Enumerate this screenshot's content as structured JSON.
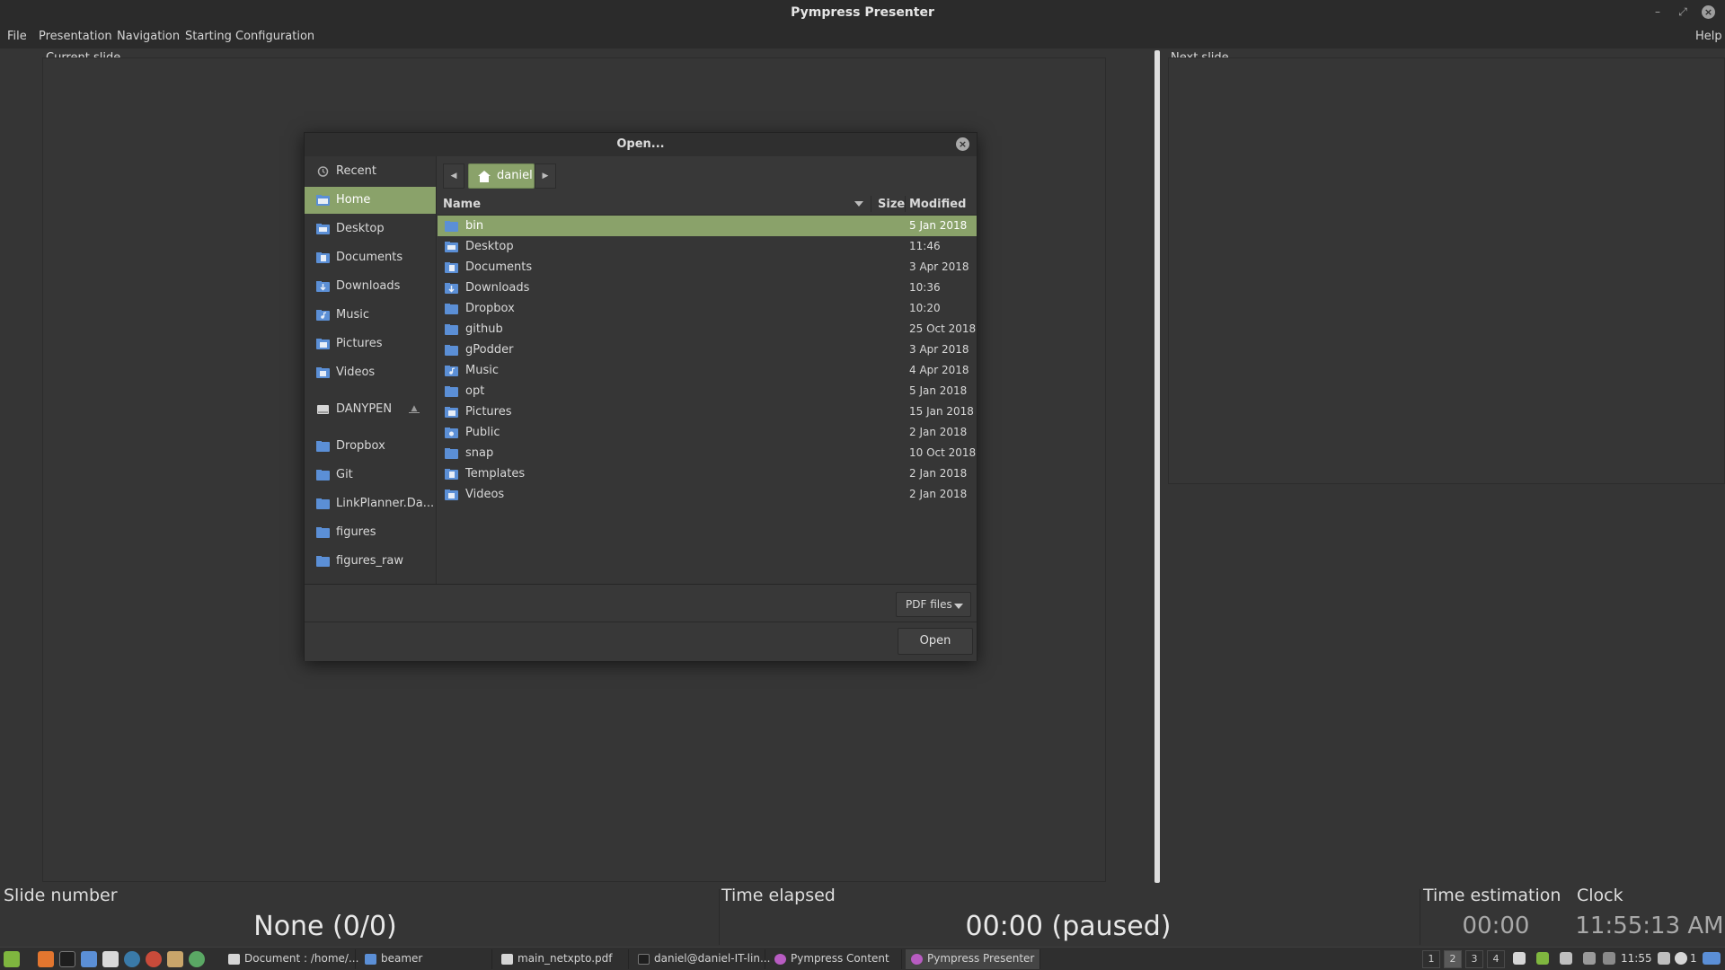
{
  "window": {
    "title": "Pympress Presenter"
  },
  "menu": [
    "File",
    "Presentation",
    "Navigation",
    "Starting Configuration"
  ],
  "menu_help": "Help",
  "panes": {
    "current": "Current slide",
    "next": "Next slide"
  },
  "info": {
    "slide_number_label": "Slide number",
    "slide_number_value": "None (0/0)",
    "time_elapsed_label": "Time elapsed",
    "time_elapsed_value": "00:00 (paused)",
    "time_estimation_label": "Time estimation",
    "time_estimation_value": "00:00",
    "clock_label": "Clock",
    "clock_value": "11:55:13 AM"
  },
  "dialog": {
    "title": "Open...",
    "places": [
      {
        "label": "Recent",
        "icon": "recent-icon",
        "selected": false
      },
      {
        "label": "Home",
        "icon": "home-folder-icon",
        "selected": true
      },
      {
        "label": "Desktop",
        "icon": "desktop-folder-icon",
        "selected": false
      },
      {
        "label": "Documents",
        "icon": "documents-folder-icon",
        "selected": false
      },
      {
        "label": "Downloads",
        "icon": "downloads-folder-icon",
        "selected": false
      },
      {
        "label": "Music",
        "icon": "music-folder-icon",
        "selected": false
      },
      {
        "label": "Pictures",
        "icon": "pictures-folder-icon",
        "selected": false
      },
      {
        "label": "Videos",
        "icon": "videos-folder-icon",
        "selected": false
      },
      {
        "label": "DANYPEN",
        "icon": "drive-icon",
        "selected": false
      },
      {
        "label": "Dropbox",
        "icon": "folder-icon",
        "selected": false
      },
      {
        "label": "Git",
        "icon": "folder-icon",
        "selected": false
      },
      {
        "label": "LinkPlanner.Da...",
        "icon": "folder-icon",
        "selected": false
      },
      {
        "label": "figures",
        "icon": "folder-icon",
        "selected": false
      },
      {
        "label": "figures_raw",
        "icon": "folder-icon",
        "selected": false
      }
    ],
    "path": {
      "current": "daniel"
    },
    "columns": {
      "name": "Name",
      "size": "Size",
      "modified": "Modified"
    },
    "files": [
      {
        "name": "bin",
        "modified": "5 Jan 2018",
        "selected": true
      },
      {
        "name": "Desktop",
        "modified": "11:46",
        "selected": false
      },
      {
        "name": "Documents",
        "modified": "3 Apr 2018",
        "selected": false
      },
      {
        "name": "Downloads",
        "modified": "10:36",
        "selected": false
      },
      {
        "name": "Dropbox",
        "modified": "10:20",
        "selected": false
      },
      {
        "name": "github",
        "modified": "25 Oct 2018",
        "selected": false
      },
      {
        "name": "gPodder",
        "modified": "3 Apr 2018",
        "selected": false
      },
      {
        "name": "Music",
        "modified": "4 Apr 2018",
        "selected": false
      },
      {
        "name": "opt",
        "modified": "5 Jan 2018",
        "selected": false
      },
      {
        "name": "Pictures",
        "modified": "15 Jan 2018",
        "selected": false
      },
      {
        "name": "Public",
        "modified": "2 Jan 2018",
        "selected": false
      },
      {
        "name": "snap",
        "modified": "10 Oct 2018",
        "selected": false
      },
      {
        "name": "Templates",
        "modified": "2 Jan 2018",
        "selected": false
      },
      {
        "name": "Videos",
        "modified": "2 Jan 2018",
        "selected": false
      }
    ],
    "filter": "PDF files",
    "open_button": "Open"
  },
  "taskbar": {
    "tasks": [
      {
        "label": "Document : /home/...",
        "active": false
      },
      {
        "label": "beamer",
        "active": false
      },
      {
        "label": "main_netxpto.pdf",
        "active": false
      },
      {
        "label": "daniel@daniel-IT-lin...",
        "active": false
      },
      {
        "label": "Pympress Content",
        "active": false
      },
      {
        "label": "Pympress Presenter",
        "active": true
      }
    ],
    "workspaces": [
      "1",
      "2",
      "3",
      "4"
    ],
    "current_workspace": "2",
    "clock": "11:55",
    "tray_count": "1",
    "tray_count2": "1"
  },
  "colors": {
    "accent": "#8aa26a",
    "background": "#353535",
    "folder": "#5b8fd6"
  }
}
